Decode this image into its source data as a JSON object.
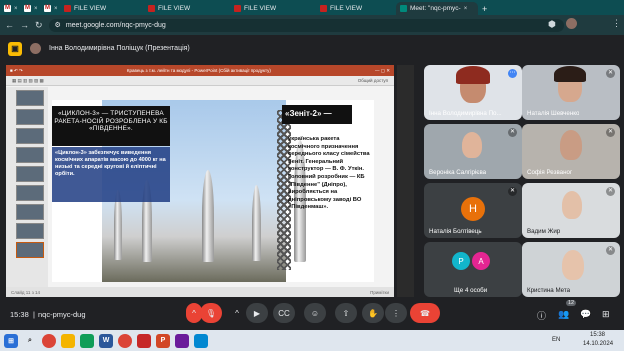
{
  "tabs": [
    {
      "label": "",
      "favicon": "gmail-icon",
      "active": false
    },
    {
      "label": "",
      "favicon": "gmail-icon",
      "active": false
    },
    {
      "label": "",
      "favicon": "gmail-icon",
      "active": false
    },
    {
      "label": "FILE VIEW",
      "favicon": "file-icon",
      "active": false
    },
    {
      "label": "FILE VIEW",
      "favicon": "file-icon",
      "active": false
    },
    {
      "label": "FILE VIEW",
      "favicon": "file-icon",
      "active": false
    },
    {
      "label": "FILE VIEW",
      "favicon": "file-icon",
      "active": false
    },
    {
      "label": "Meet: \"nqc-pmyc-",
      "favicon": "meet-icon",
      "active": true
    }
  ],
  "address": {
    "url": "meet.google.com/nqc-pmyc-dug"
  },
  "header": {
    "presenter": "Інна Володимирівна Поліщук (Презентація)"
  },
  "ppt": {
    "title_bar": "Кравець з т.м. лейтн та модулі - PowerPoint (Сбій активації продукту)",
    "share": "Общий доступ",
    "slide_title": "«ЦИКЛОН-3» — ТРИСТУПЕНЕВА РАКЕТА-НОСІЙ РОЗРОБЛЕНА У КБ «ПІВДЕННЕ».",
    "slide_blue": "«Циклон-3» забезпечує виведення космічних апаратів масою до 4000 кг на низькі та середні кругові й еліптичні орбіти.",
    "zenit_title": "«Зеніт-2» —",
    "zenit_text": "українська ракета космічного призначення середнього класу сімейства Зеніт. Генеральний конструктор — В. Ф. Уткін. Головний розробник — КБ \"Південне\" (Дніпро), виробляється на дніпровському заводі ВО «Південмаш».",
    "status_left": "Слайд 11 з 14",
    "status_right": "Примітки"
  },
  "participants": [
    {
      "name": "Інна Володимирівна По...",
      "type": "video",
      "muted": false
    },
    {
      "name": "Наталія Шевченко",
      "type": "video",
      "muted": true
    },
    {
      "name": "Вероніка Салгірієва",
      "type": "video",
      "muted": true
    },
    {
      "name": "Софія Резваног",
      "type": "video",
      "muted": true
    },
    {
      "name": "Наталія Болтівець",
      "type": "avatar",
      "initial": "H",
      "color": "#e8710a",
      "muted": true
    },
    {
      "name": "Вадим Жир",
      "type": "video",
      "muted": true
    },
    {
      "name": "Ще 4 особи",
      "type": "group",
      "initials": [
        "P",
        "A"
      ]
    },
    {
      "name": "Кристина Мета",
      "type": "video",
      "muted": true
    }
  ],
  "bottom": {
    "time": "15:38",
    "meeting": "nqc-pmyc-dug",
    "people_count": "12"
  },
  "taskbar": {
    "lang": "EN",
    "time": "15:38",
    "date": "14.10.2024"
  }
}
